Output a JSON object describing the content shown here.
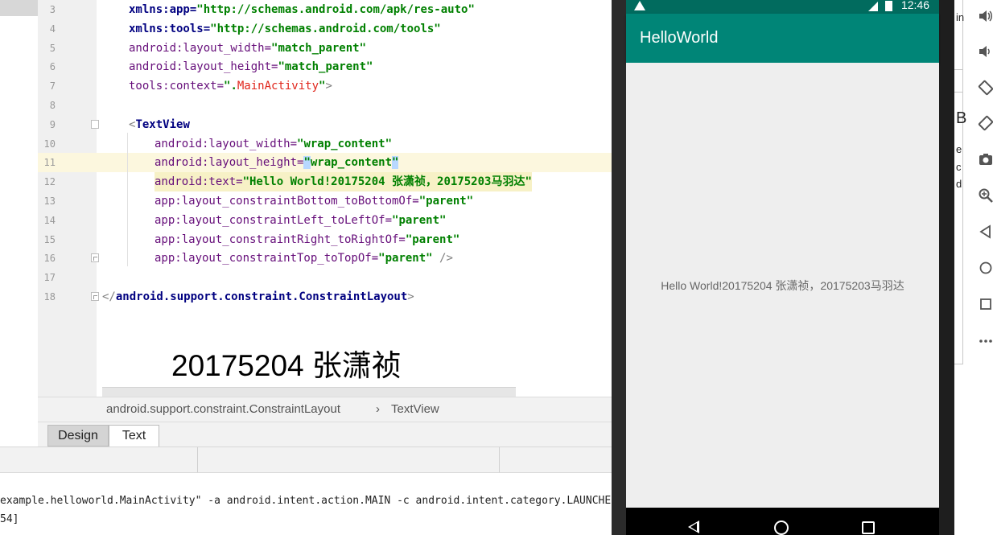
{
  "editor": {
    "lines": [
      {
        "n": "3",
        "parts": [
          {
            "t": "xmlns:app=",
            "c": "ns"
          },
          {
            "t": "\"http://schemas.android.com/apk/res-auto\"",
            "c": "val"
          }
        ]
      },
      {
        "n": "4",
        "parts": [
          {
            "t": "xmlns:tools=",
            "c": "ns"
          },
          {
            "t": "\"http://schemas.android.com/tools\"",
            "c": "val"
          }
        ]
      },
      {
        "n": "5",
        "parts": [
          {
            "t": "android:layout_width=",
            "c": "attr"
          },
          {
            "t": "\"match_parent\"",
            "c": "val"
          }
        ]
      },
      {
        "n": "6",
        "parts": [
          {
            "t": "android:layout_height=",
            "c": "attr"
          },
          {
            "t": "\"match_parent\"",
            "c": "val"
          }
        ]
      },
      {
        "n": "7",
        "parts": [
          {
            "t": "tools:context=",
            "c": "attr"
          },
          {
            "t": "\".",
            "c": "val"
          },
          {
            "t": "MainActivity",
            "c": "red"
          },
          {
            "t": "\"",
            "c": "val"
          },
          {
            "t": ">",
            "c": "gray"
          }
        ]
      },
      {
        "n": "8",
        "parts": []
      },
      {
        "n": "9",
        "parts": [
          {
            "t": "<",
            "c": "gray"
          },
          {
            "t": "TextView",
            "c": "tag"
          }
        ]
      },
      {
        "n": "10",
        "parts": [
          {
            "t": "android:layout_width=",
            "c": "attr"
          },
          {
            "t": "\"wrap_content\"",
            "c": "val"
          }
        ]
      },
      {
        "n": "11",
        "parts": [
          {
            "t": "android:layout_height=",
            "c": "attr"
          },
          {
            "t": "\"",
            "c": "val"
          },
          {
            "t": "wrap_content",
            "c": "val"
          },
          {
            "t": "\"",
            "c": "val"
          }
        ]
      },
      {
        "n": "12",
        "parts": [
          {
            "t": "android:text=",
            "c": "attr"
          },
          {
            "t": "\"Hello World!20175204 张潇祯，20175203马羽达\"",
            "c": "val"
          }
        ]
      },
      {
        "n": "13",
        "parts": [
          {
            "t": "app:layout_constraintBottom_toBottomOf=",
            "c": "attr"
          },
          {
            "t": "\"parent\"",
            "c": "val"
          }
        ]
      },
      {
        "n": "14",
        "parts": [
          {
            "t": "app:layout_constraintLeft_toLeftOf=",
            "c": "attr"
          },
          {
            "t": "\"parent\"",
            "c": "val"
          }
        ]
      },
      {
        "n": "15",
        "parts": [
          {
            "t": "app:layout_constraintRight_toRightOf=",
            "c": "attr"
          },
          {
            "t": "\"parent\"",
            "c": "val"
          }
        ]
      },
      {
        "n": "16",
        "parts": [
          {
            "t": "app:layout_constraintTop_toTopOf=",
            "c": "attr"
          },
          {
            "t": "\"parent\"",
            "c": "val"
          },
          {
            "t": " />",
            "c": "gray"
          }
        ]
      },
      {
        "n": "17",
        "parts": []
      },
      {
        "n": "18",
        "parts": [
          {
            "t": "</",
            "c": "gray"
          },
          {
            "t": "android.support.constraint.ConstraintLayout",
            "c": "tag"
          },
          {
            "t": ">",
            "c": "gray"
          }
        ]
      }
    ],
    "preview_text": "20175204 张潇祯"
  },
  "breadcrumb": {
    "item1": "android.support.constraint.ConstraintLayout",
    "separator": "›",
    "item2": "TextView"
  },
  "tabs": {
    "design": "Design",
    "text": "Text"
  },
  "console": {
    "line1": "example.helloworld.MainActivity\" -a android.intent.action.MAIN -c android.intent.category.LAUNCHER",
    "line2": "54]"
  },
  "emulator": {
    "time": "12:46",
    "app_title": "HelloWorld",
    "hello_text": "Hello World!20175204 张潇祯，20175203马羽达",
    "theme_colors": {
      "status": "#016b5e",
      "appbar": "#008577",
      "background": "#eeeeee"
    }
  },
  "side_fragments": {
    "a": "in",
    "b": "B",
    "c": "e",
    "d": "c",
    "e": "d"
  },
  "toolbar_icons": [
    "volume-up-icon",
    "volume-down-icon",
    "rotate-left-icon",
    "rotate-right-icon",
    "camera-icon",
    "zoom-icon",
    "back-icon",
    "home-icon",
    "overview-icon",
    "more-icon"
  ]
}
